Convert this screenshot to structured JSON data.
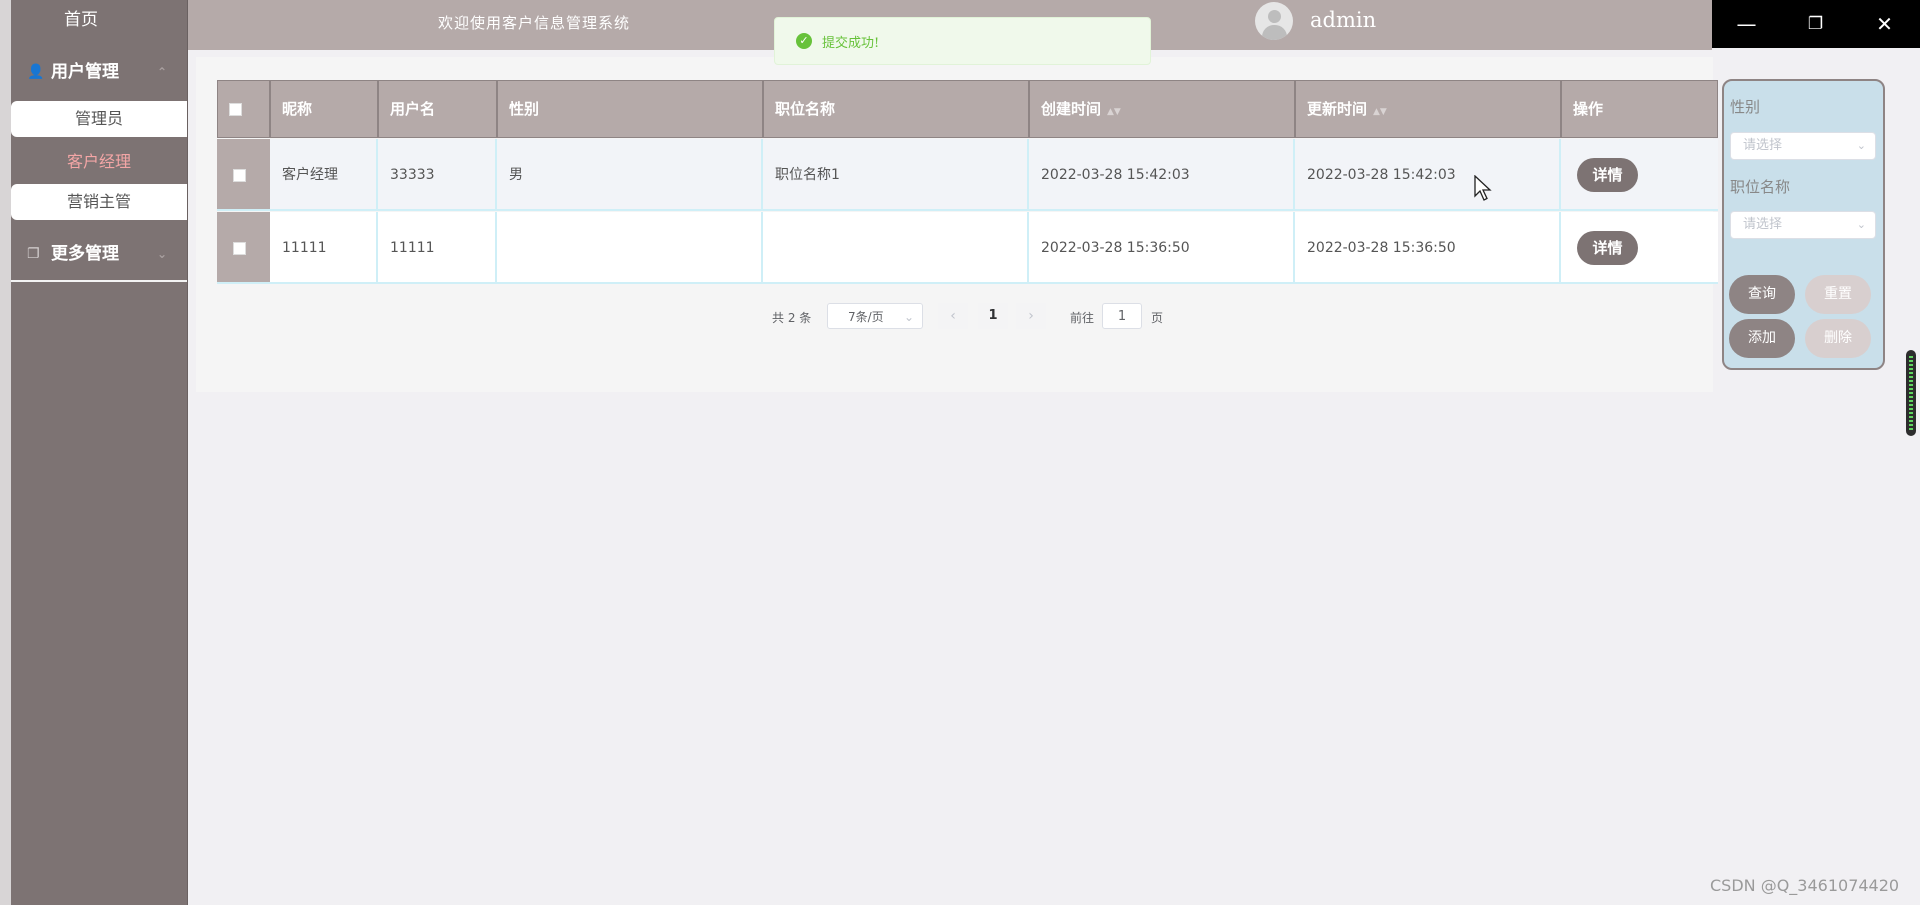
{
  "sidebar": {
    "home": "首页",
    "groups": [
      {
        "label": "用户管理",
        "icon": "user-icon"
      },
      {
        "label": "更多管理",
        "icon": "copy-icon"
      }
    ],
    "items": [
      {
        "label": "管理员"
      },
      {
        "label": "客户经理",
        "active": true
      },
      {
        "label": "营销主管"
      }
    ]
  },
  "header": {
    "title": "欢迎使用客户信息管理系统",
    "username": "admin"
  },
  "toast": {
    "message": "提交成功!",
    "icon": "check-circle-icon"
  },
  "table": {
    "columns": [
      "昵称",
      "用户名",
      "性别",
      "职位名称",
      "创建时间",
      "更新时间",
      "操作"
    ],
    "rows": [
      {
        "nickname": "客户经理",
        "username": "33333",
        "gender": "男",
        "position": "职位名称1",
        "created": "2022-03-28 15:42:03",
        "updated": "2022-03-28 15:42:03",
        "action": "详情"
      },
      {
        "nickname": "11111",
        "username": "11111",
        "gender": "",
        "position": "",
        "created": "2022-03-28 15:36:50",
        "updated": "2022-03-28 15:36:50",
        "action": "详情"
      }
    ]
  },
  "pagination": {
    "total": "共 2 条",
    "page_size": "7条/页",
    "current_page": "1",
    "goto_label": "前往",
    "goto_value": "1",
    "page_suffix": "页"
  },
  "search": {
    "gender_label": "性别",
    "gender_placeholder": "请选择",
    "position_label": "职位名称",
    "position_placeholder": "请选择",
    "query_button": "查询",
    "reset_button": "重置",
    "add_button": "添加",
    "delete_button": "删除"
  },
  "watermark": "CSDN @Q_3461074420"
}
